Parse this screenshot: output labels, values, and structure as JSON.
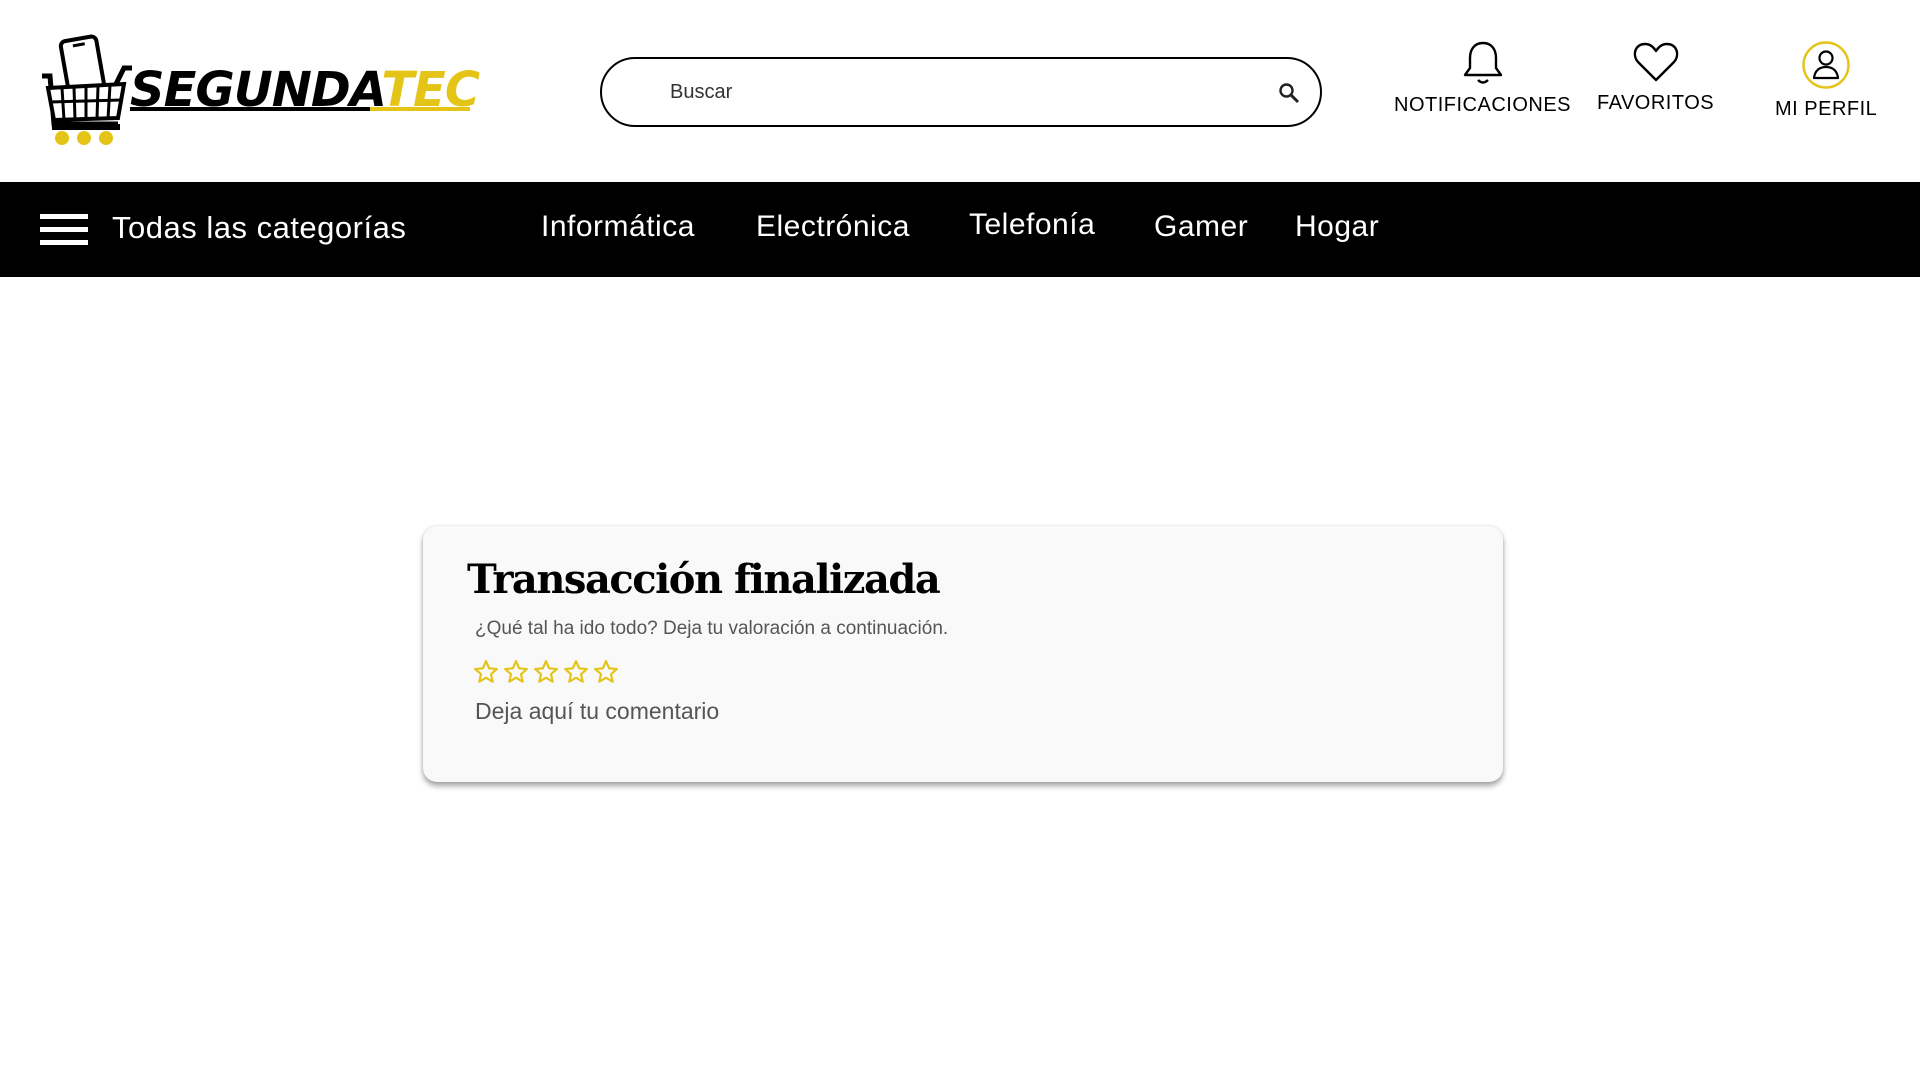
{
  "header": {
    "logo": {
      "text_main": "SEGUNDA",
      "text_accent": "TEC"
    },
    "search": {
      "placeholder": "Buscar",
      "value": ""
    },
    "actions": [
      {
        "label": "NOTIFICACIONES",
        "icon": "bell-icon"
      },
      {
        "label": "FAVORITOS",
        "icon": "heart-icon"
      },
      {
        "label": "MI PERFIL",
        "icon": "user-icon"
      }
    ]
  },
  "nav": {
    "all_categories": "Todas las categorías",
    "items": [
      "Informática",
      "Electrónica",
      "Telefonía",
      "Gamer",
      "Hogar"
    ]
  },
  "review_card": {
    "title": "Transacción finalizada",
    "subtitle": "¿Qué tal ha ido todo? Deja tu valoración a continuación.",
    "rating": {
      "value": 0,
      "max": 5
    },
    "comment": {
      "placeholder": "Deja aquí tu comentario",
      "value": ""
    }
  },
  "colors": {
    "accent": "#e3c417",
    "nav_background": "#000000",
    "card_background": "#f9f9f9"
  }
}
